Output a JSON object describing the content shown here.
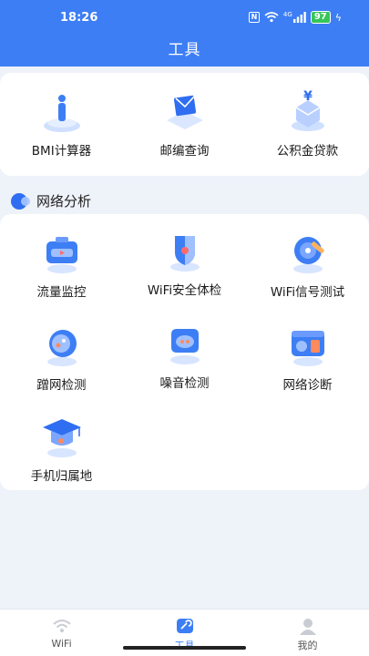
{
  "status_bar": {
    "time": "18:26",
    "nfc": "N",
    "network": "4G",
    "battery": "97"
  },
  "header": {
    "title": "工具"
  },
  "top_tools": [
    {
      "label": "BMI计算器",
      "icon": "bmi-person-icon"
    },
    {
      "label": "邮编查询",
      "icon": "mail-envelope-icon"
    },
    {
      "label": "公积金贷款",
      "icon": "yuan-coin-icon"
    }
  ],
  "section": {
    "title": "网络分析"
  },
  "network_tools": [
    {
      "label": "流量监控",
      "icon": "traffic-monitor-icon"
    },
    {
      "label": "WiFi安全体检",
      "icon": "wifi-shield-icon"
    },
    {
      "label": "WiFi信号测试",
      "icon": "signal-test-icon"
    },
    {
      "label": "蹭网检测",
      "icon": "freeloader-detect-icon"
    },
    {
      "label": "噪音检测",
      "icon": "noise-detect-icon"
    },
    {
      "label": "网络诊断",
      "icon": "network-diagnose-icon"
    },
    {
      "label": "手机归属地",
      "icon": "phone-location-icon"
    }
  ],
  "tabbar": [
    {
      "label": "WiFi",
      "icon": "wifi-tab-icon",
      "active": false
    },
    {
      "label": "工具",
      "icon": "tools-tab-icon",
      "active": true
    },
    {
      "label": "我的",
      "icon": "profile-tab-icon",
      "active": false
    }
  ],
  "colors": {
    "primary": "#3d7ef5",
    "background": "#eef2f9",
    "battery": "#37c55a"
  }
}
